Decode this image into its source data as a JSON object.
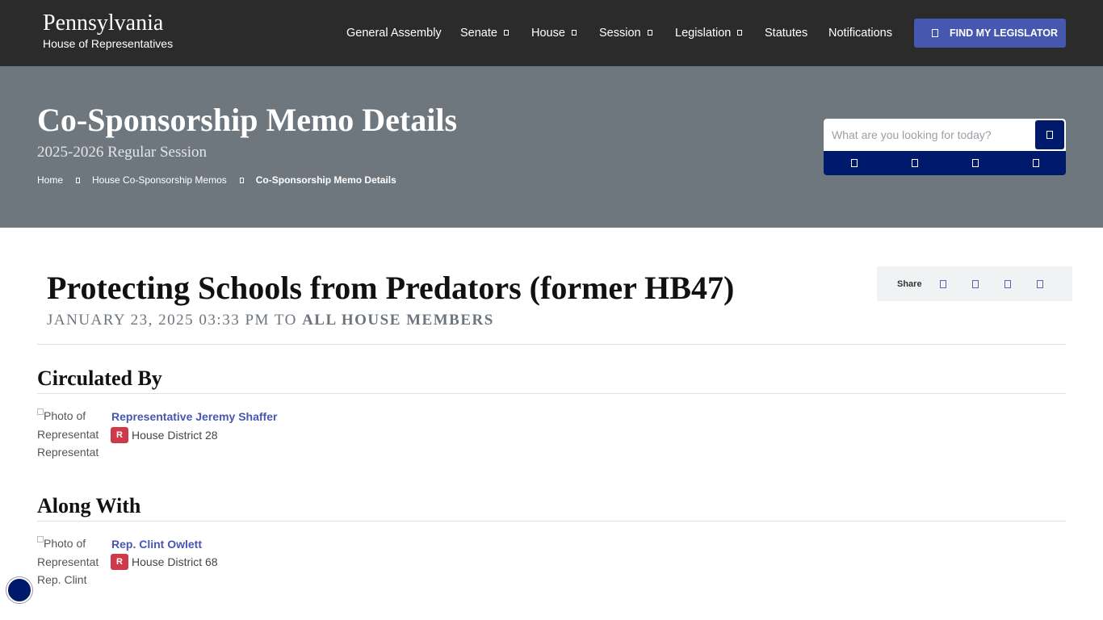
{
  "header": {
    "brand_title": "Pennsylvania",
    "brand_subtitle": "House of Representatives",
    "nav": [
      {
        "label": "General Assembly",
        "dropdown": false
      },
      {
        "label": "Senate",
        "dropdown": true
      },
      {
        "label": "House",
        "dropdown": true
      },
      {
        "label": "Session",
        "dropdown": true
      },
      {
        "label": "Legislation",
        "dropdown": true
      },
      {
        "label": "Statutes",
        "dropdown": false
      },
      {
        "label": "Notifications",
        "dropdown": false
      }
    ],
    "find_button": "FIND MY LEGISLATOR"
  },
  "hero": {
    "title": "Co-Sponsorship Memo Details",
    "session": "2025-2026 Regular Session",
    "breadcrumb": [
      "Home",
      "House Co-Sponsorship Memos",
      "Co-Sponsorship Memo Details"
    ],
    "search_placeholder": "What are you looking for today?"
  },
  "memo": {
    "title": "Protecting Schools from Predators (former HB47)",
    "date": "JANUARY 23, 2025 03:33 PM",
    "to_word": "TO",
    "recipients": "ALL HOUSE MEMBERS",
    "share_label": "Share"
  },
  "circulated_by": {
    "heading": "Circulated By",
    "photo_alt": "Photo of Representative Representative",
    "name": "Representative Jeremy Shaffer",
    "party": "R",
    "district": "House District 28"
  },
  "along_with": {
    "heading": "Along With",
    "photo_alt": "Photo of Representative Rep. Clint Owlett",
    "name": "Rep. Clint Owlett",
    "party": "R",
    "district": "House District 68"
  },
  "colors": {
    "topbar": "#2b2b2b",
    "hero": "#6f777e",
    "accent": "#4657b0",
    "navy": "#001a6b",
    "republican": "#cf3a4a"
  }
}
